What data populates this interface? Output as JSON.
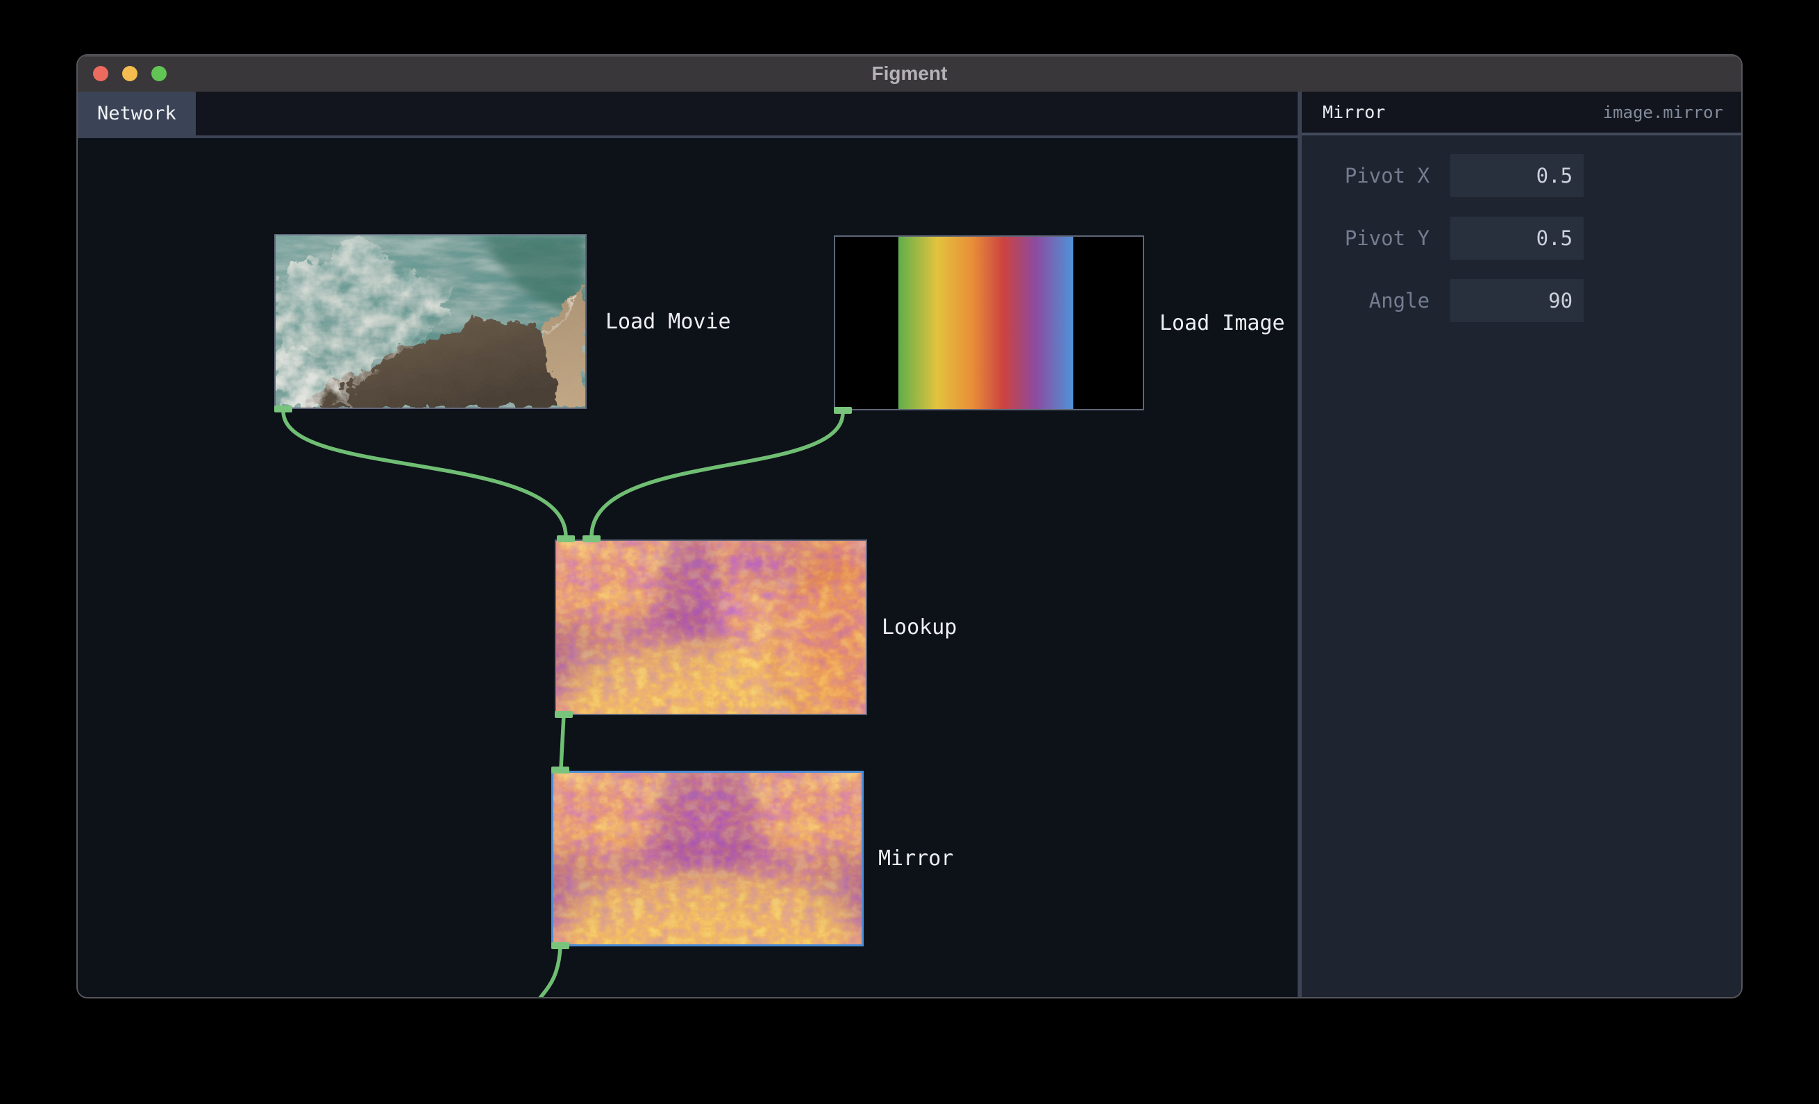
{
  "window": {
    "title": "Figment"
  },
  "tab_bar": {
    "tabs": [
      {
        "label": "Network",
        "active": true
      }
    ]
  },
  "canvas": {
    "nodes": [
      {
        "label": "Load Movie",
        "selected": false
      },
      {
        "label": "Load Image",
        "selected": false
      },
      {
        "label": "Lookup",
        "selected": false
      },
      {
        "label": "Mirror",
        "selected": true
      }
    ]
  },
  "inspector": {
    "title": "Mirror",
    "type": "image.mirror",
    "params": [
      {
        "label": "Pivot X",
        "value": "0.5"
      },
      {
        "label": "Pivot Y",
        "value": "0.5"
      },
      {
        "label": "Angle",
        "value": "90"
      }
    ]
  },
  "colors": {
    "wire": "#6fbe73",
    "port": "#78c47c",
    "selection": "#4b8ed8"
  }
}
